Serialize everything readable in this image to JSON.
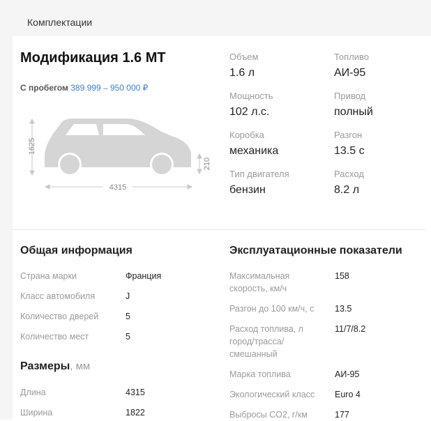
{
  "header": {
    "title": "Комплектации"
  },
  "modification": {
    "title": "Модификация 1.6 MT",
    "price_prefix": "С пробегом",
    "price_range": "389 999 – 950 000 ₽"
  },
  "dimensions_drawing": {
    "height": "1625",
    "length": "4315",
    "clearance": "210"
  },
  "specs": [
    {
      "label": "Объем",
      "value": "1.6 л"
    },
    {
      "label": "Топливо",
      "value": "АИ-95"
    },
    {
      "label": "Мощность",
      "value": "102 л.с."
    },
    {
      "label": "Привод",
      "value": "полный"
    },
    {
      "label": "Коробка",
      "value": "механика"
    },
    {
      "label": "Разгон",
      "value": "13.5 с"
    },
    {
      "label": "Тип двигателя",
      "value": "бензин"
    },
    {
      "label": "Расход",
      "value": "8.2 л"
    }
  ],
  "general": {
    "title": "Общая информация",
    "rows": [
      {
        "label": "Страна марки",
        "value": "Франция"
      },
      {
        "label": "Класс автомобиля",
        "value": "J"
      },
      {
        "label": "Количество дверей",
        "value": "5"
      },
      {
        "label": "Количество мест",
        "value": "5"
      }
    ]
  },
  "sizes": {
    "title": "Размеры",
    "unit": ", мм",
    "rows": [
      {
        "label": "Длина",
        "value": "4315"
      },
      {
        "label": "Ширина",
        "value": "1822"
      }
    ]
  },
  "performance": {
    "title": "Эксплуатационные показатели",
    "rows": [
      {
        "label": "Максимальная скорость, км/ч",
        "value": "158"
      },
      {
        "label": "Разгон до 100 км/ч, с",
        "value": "13.5"
      },
      {
        "label": "Расход топлива, л город/трасса/смешанный",
        "value": "11/7/8.2"
      },
      {
        "label": "Марка топлива",
        "value": "АИ-95"
      },
      {
        "label": "Экологический класс",
        "value": "Euro 4"
      },
      {
        "label": "Выбросы CO2, г/км",
        "value": "177"
      }
    ]
  },
  "colors": {
    "accent": "#3b7dd8",
    "car_gray": "#d5d5d5",
    "muted_text": "#9a9a9a"
  }
}
